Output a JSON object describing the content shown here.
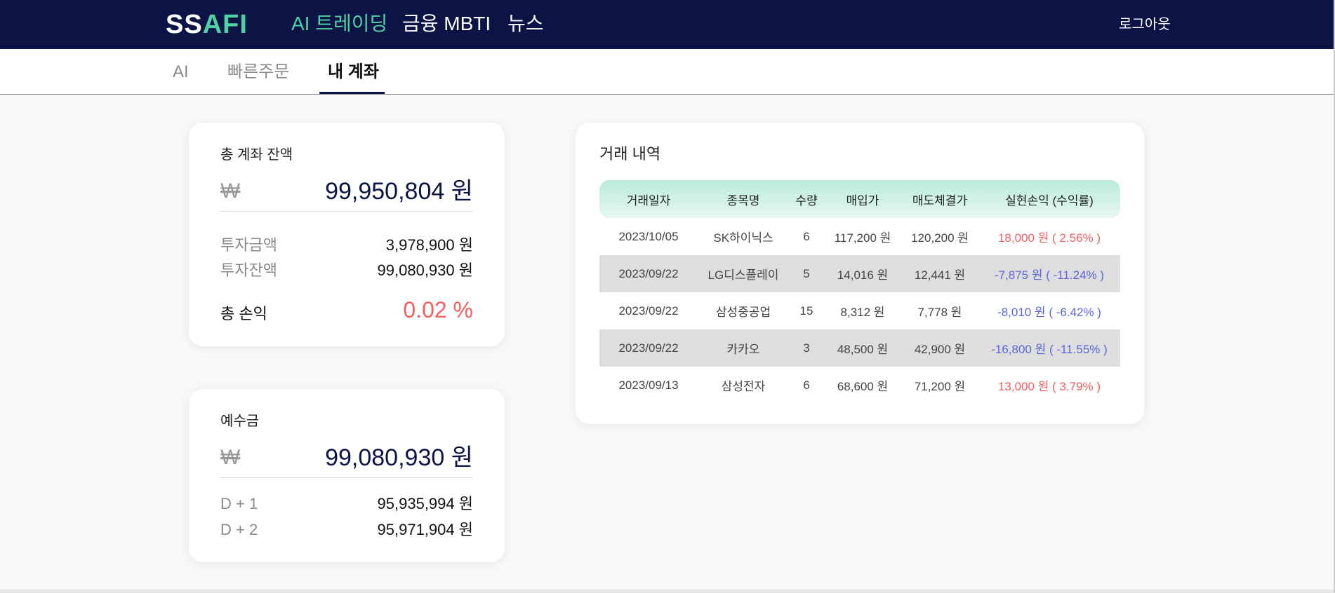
{
  "header": {
    "logo_part1": "SS",
    "logo_part2": "AFI",
    "nav": [
      "AI 트레이딩",
      "금융 MBTI",
      "뉴스"
    ],
    "logout": "로그아웃"
  },
  "subnav": {
    "tabs": [
      "AI",
      "빠른주문",
      "내 계좌"
    ],
    "active_tab": "내 계좌"
  },
  "balance": {
    "title": "총 계좌 잔액",
    "currency_symbol": "₩",
    "total": "99,950,804 원",
    "rows": [
      {
        "label": "투자금액",
        "value": "3,978,900 원"
      },
      {
        "label": "투자잔액",
        "value": "99,080,930 원"
      }
    ],
    "pl_label": "총 손익",
    "pl_value": "0.02 %"
  },
  "deposit": {
    "title": "예수금",
    "currency_symbol": "₩",
    "total": "99,080,930 원",
    "rows": [
      {
        "label": "D + 1",
        "value": "95,935,994 원"
      },
      {
        "label": "D + 2",
        "value": "95,971,904 원"
      }
    ]
  },
  "history": {
    "title": "거래 내역",
    "columns": [
      "거래일자",
      "종목명",
      "수량",
      "매입가",
      "매도체결가",
      "실현손익 (수익률)"
    ],
    "rows": [
      {
        "date": "2023/10/05",
        "name": "SK하이닉스",
        "qty": "6",
        "buy": "117,200 원",
        "sell": "120,200 원",
        "pl": "18,000 원 ( 2.56% )",
        "sign": "pos"
      },
      {
        "date": "2023/09/22",
        "name": "LG디스플레이",
        "qty": "5",
        "buy": "14,016 원",
        "sell": "12,441 원",
        "pl": "-7,875 원 ( -11.24% )",
        "sign": "neg"
      },
      {
        "date": "2023/09/22",
        "name": "삼성중공업",
        "qty": "15",
        "buy": "8,312 원",
        "sell": "7,778 원",
        "pl": "-8,010 원 ( -6.42% )",
        "sign": "neg"
      },
      {
        "date": "2023/09/22",
        "name": "카카오",
        "qty": "3",
        "buy": "48,500 원",
        "sell": "42,900 원",
        "pl": "-16,800 원 ( -11.55% )",
        "sign": "neg"
      },
      {
        "date": "2023/09/13",
        "name": "삼성전자",
        "qty": "6",
        "buy": "68,600 원",
        "sell": "71,200 원",
        "pl": "13,000 원 ( 3.79% )",
        "sign": "pos"
      }
    ]
  },
  "colors": {
    "navy": "#0c1445",
    "accent_green": "#4fd1a5",
    "profit_red": "#f25f5f",
    "loss_blue": "#5866d8"
  }
}
